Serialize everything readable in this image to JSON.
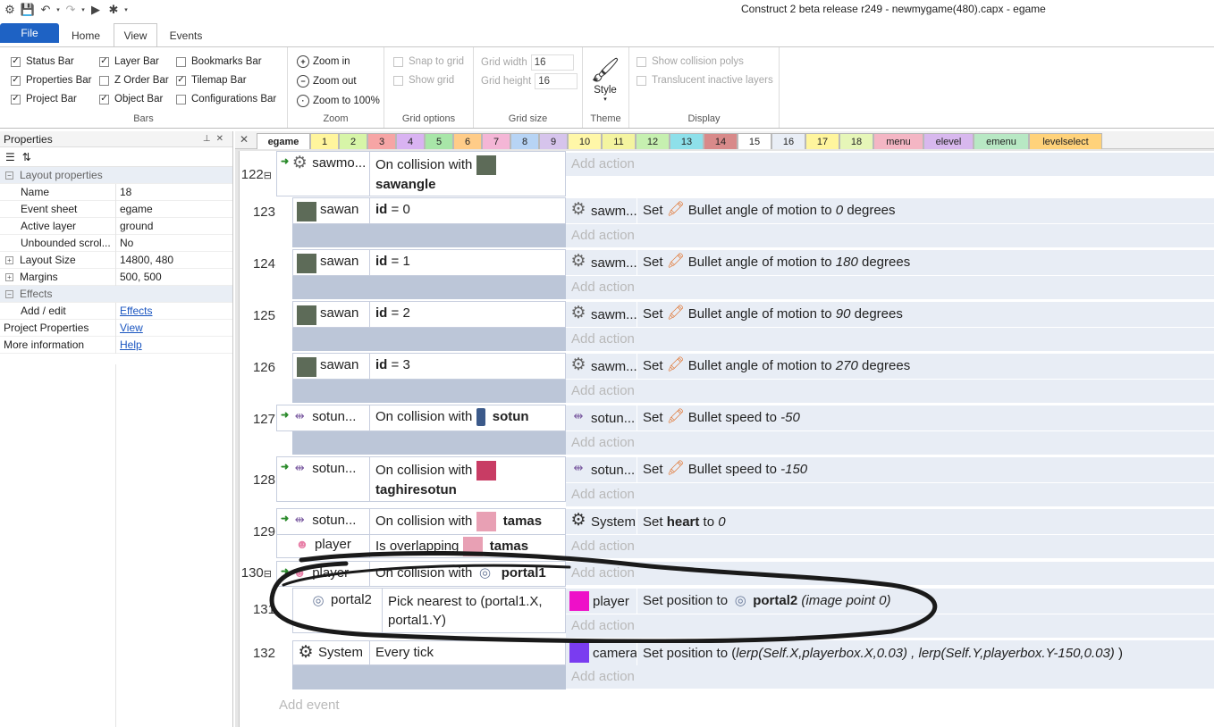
{
  "window": {
    "title": "Construct 2 beta release r249 - newmygame(480).capx - egame"
  },
  "ribbon_tabs": [
    "File",
    "Home",
    "View",
    "Events"
  ],
  "bars_group": {
    "label": "Bars",
    "items": [
      {
        "label": "Status Bar",
        "checked": true
      },
      {
        "label": "Properties Bar",
        "checked": true
      },
      {
        "label": "Project Bar",
        "checked": true
      },
      {
        "label": "Layer Bar",
        "checked": true
      },
      {
        "label": "Z Order Bar",
        "checked": false
      },
      {
        "label": "Object Bar",
        "checked": true
      },
      {
        "label": "Bookmarks Bar",
        "checked": false
      },
      {
        "label": "Tilemap Bar",
        "checked": true
      },
      {
        "label": "Configurations Bar",
        "checked": false
      }
    ]
  },
  "zoom_group": {
    "label": "Zoom",
    "zoom_in": "Zoom in",
    "zoom_out": "Zoom out",
    "zoom_100": "Zoom to 100%"
  },
  "grid_options": {
    "label": "Grid options",
    "snap": "Snap to grid",
    "show": "Show grid"
  },
  "grid_size": {
    "label": "Grid size",
    "width_label": "Grid width",
    "width": "16",
    "height_label": "Grid height",
    "height": "16"
  },
  "theme": {
    "label": "Theme",
    "style": "Style"
  },
  "display": {
    "label": "Display",
    "collision": "Show collision polys",
    "translucent": "Translucent inactive layers"
  },
  "properties": {
    "title": "Properties",
    "category_layout": "Layout properties",
    "rows": [
      {
        "key": "Name",
        "value": "18"
      },
      {
        "key": "Event sheet",
        "value": "egame"
      },
      {
        "key": "Active layer",
        "value": "ground"
      },
      {
        "key": "Unbounded scrol...",
        "value": "No"
      },
      {
        "key": "Layout Size",
        "value": "14800, 480"
      },
      {
        "key": "Margins",
        "value": "500, 500"
      }
    ],
    "category_effects": "Effects",
    "add_edit": {
      "key": "Add / edit",
      "value": "Effects"
    },
    "project_properties": {
      "key": "Project Properties",
      "value": "View"
    },
    "more_info": {
      "key": "More information",
      "value": "Help"
    }
  },
  "sheet_tabs": [
    {
      "label": "egame",
      "color": "#ffffff"
    },
    {
      "label": "1",
      "color": "#fff59d"
    },
    {
      "label": "2",
      "color": "#d7f5a8"
    },
    {
      "label": "3",
      "color": "#f6a5a5"
    },
    {
      "label": "4",
      "color": "#d9b3f2"
    },
    {
      "label": "5",
      "color": "#a8e6a8"
    },
    {
      "label": "6",
      "color": "#ffcc88"
    },
    {
      "label": "7",
      "color": "#f4b6d6"
    },
    {
      "label": "8",
      "color": "#b7d4f5"
    },
    {
      "label": "9",
      "color": "#d6c4ec"
    },
    {
      "label": "10",
      "color": "#fff7a8"
    },
    {
      "label": "11",
      "color": "#f4f4a0"
    },
    {
      "label": "12",
      "color": "#c6f0b0"
    },
    {
      "label": "13",
      "color": "#8ee0ea"
    },
    {
      "label": "14",
      "color": "#d88a8a"
    },
    {
      "label": "15",
      "color": "#ffffff"
    },
    {
      "label": "16",
      "color": "#e9eef6"
    },
    {
      "label": "17",
      "color": "#fff59d"
    },
    {
      "label": "18",
      "color": "#e6f6b8"
    },
    {
      "label": "menu",
      "color": "#f4b6c4"
    },
    {
      "label": "elevel",
      "color": "#d8b8ee"
    },
    {
      "label": "emenu",
      "color": "#b8e8c4"
    },
    {
      "label": "levelselect",
      "color": "#ffd27a"
    }
  ],
  "events": {
    "e122": {
      "num": "122",
      "obj": "sawmo...",
      "text": "On collision with",
      "target": "sawangle",
      "add": "Add action"
    },
    "e123": {
      "num": "123",
      "obj": "sawan",
      "cond": "id",
      "op": "= 0",
      "aobj": "sawm...",
      "a1": "Set",
      "a2": "Bullet angle of motion to",
      "val": "0",
      "unit": "degrees",
      "add": "Add action"
    },
    "e124": {
      "num": "124",
      "obj": "sawan",
      "cond": "id",
      "op": "= 1",
      "aobj": "sawm...",
      "a1": "Set",
      "a2": "Bullet angle of motion to",
      "val": "180",
      "unit": "degrees",
      "add": "Add action"
    },
    "e125": {
      "num": "125",
      "obj": "sawan",
      "cond": "id",
      "op": "= 2",
      "aobj": "sawm...",
      "a1": "Set",
      "a2": "Bullet angle of motion to",
      "val": "90",
      "unit": "degrees",
      "add": "Add action"
    },
    "e126": {
      "num": "126",
      "obj": "sawan",
      "cond": "id",
      "op": "= 3",
      "aobj": "sawm...",
      "a1": "Set",
      "a2": "Bullet angle of motion to",
      "val": "270",
      "unit": "degrees",
      "add": "Add action"
    },
    "e127": {
      "num": "127",
      "obj": "sotun...",
      "text": "On collision with",
      "target": "sotun",
      "aobj": "sotun...",
      "a1": "Set",
      "a2": "Bullet speed to",
      "val": "-50",
      "add": "Add action"
    },
    "e128": {
      "num": "128",
      "obj": "sotun...",
      "text": "On collision with",
      "target": "taghiresotun",
      "aobj": "sotun...",
      "a1": "Set",
      "a2": "Bullet speed to",
      "val": "-150",
      "add": "Add action"
    },
    "e129": {
      "num": "129",
      "obj": "sotun...",
      "text": "On collision with",
      "target": "tamas",
      "obj2": "player",
      "text2": "Is overlapping",
      "target2": "tamas",
      "aobj": "System",
      "a1": "Set",
      "a2": "heart",
      "a3": "to",
      "val": "0",
      "add": "Add action"
    },
    "e130": {
      "num": "130",
      "obj": "player",
      "text": "On collision with",
      "target": "portal1",
      "add": "Add action"
    },
    "e131": {
      "num": "131",
      "obj": "portal2",
      "text": "Pick nearest to (portal1.X,",
      "text2": "portal1.Y)",
      "aobj": "player",
      "a1": "Set position to",
      "target": "portal2",
      "val": "(image point 0)",
      "add": "Add action"
    },
    "e132": {
      "num": "132",
      "obj": "System",
      "text": "Every tick",
      "aobj": "camera",
      "a1": "Set position to (",
      "val": "lerp(Self.X,playerbox.X,0.03) , lerp(Self.Y,playerbox.Y-150,0.03)",
      "a3": ")",
      "add": "Add action"
    },
    "add_event": "Add event"
  },
  "colors": {
    "sawan": "#5d6b58",
    "taghiresotun": "#c83c64",
    "tamas": "#e8a0b4",
    "player_action": "#ee10c8",
    "camera": "#7a3cf0",
    "accent": "#1e62c4"
  }
}
